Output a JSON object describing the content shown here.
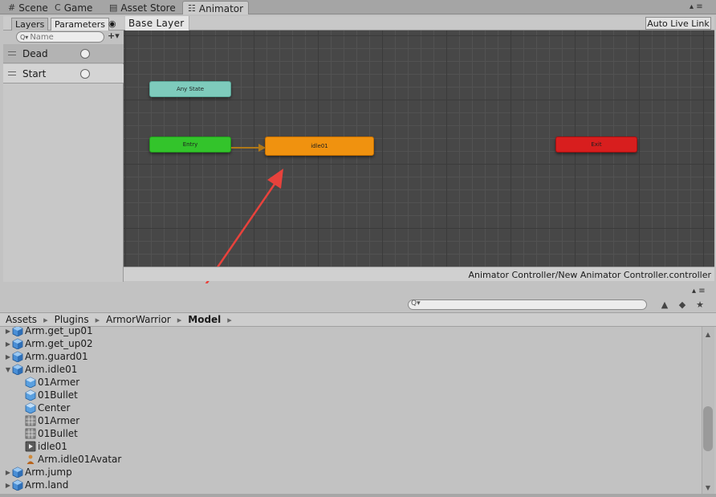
{
  "top_tabs": [
    {
      "label": "Scene",
      "icon": "scene-icon",
      "glyph": "#"
    },
    {
      "label": "Game",
      "icon": "game-icon",
      "glyph": "C"
    },
    {
      "label": "Asset Store",
      "icon": "asset-store-icon",
      "glyph": "▤"
    },
    {
      "label": "Animator",
      "icon": "animator-icon",
      "glyph": "☷",
      "active": true
    }
  ],
  "animator": {
    "sub_tabs": [
      "Layers",
      "Parameters"
    ],
    "active_sub_tab": "Parameters",
    "eye_glyph": "◉",
    "search_placeholder": "Name",
    "search_glyph": "Q▾",
    "add_glyph": "+▾",
    "parameters": [
      {
        "name": "Dead"
      },
      {
        "name": "Start"
      }
    ],
    "layer_breadcrumb": "Base Layer",
    "auto_live_link": "Auto Live Link",
    "states": {
      "any_state": "Any State",
      "entry": "Entry",
      "idle": "idle01",
      "exit": "Exit"
    },
    "controller_path": "Animator Controller/New Animator Controller.controller",
    "colors": {
      "any_state": "#7ecbbc",
      "entry": "#33c42b",
      "idle": "#f0920f",
      "exit": "#d81e1e",
      "graph_bg": "#474747",
      "annotation": "#e8423c"
    }
  },
  "project": {
    "window_controls": "▴ ≡",
    "search_value": "",
    "toolbar_icons": [
      "filter-icon",
      "label-icon",
      "favorite-icon"
    ],
    "toolbar_glyphs": [
      "▲",
      "◆",
      "★"
    ],
    "breadcrumbs": [
      "Assets",
      "Plugins",
      "ArmorWarrior",
      "Model"
    ],
    "crumb_sep": "▸",
    "scroll_glyphs": [
      "▲",
      "▼"
    ],
    "tree": [
      {
        "label": "Arm.get_up01",
        "level": 0,
        "arrow": "▶",
        "icon": "model-icon"
      },
      {
        "label": "Arm.get_up02",
        "level": 0,
        "arrow": "▶",
        "icon": "model-icon"
      },
      {
        "label": "Arm.guard01",
        "level": 0,
        "arrow": "▶",
        "icon": "model-icon"
      },
      {
        "label": "Arm.idle01",
        "level": 0,
        "arrow": "▼",
        "icon": "model-icon"
      },
      {
        "label": "01Armer",
        "level": 1,
        "arrow": "",
        "icon": "mesh-object-icon"
      },
      {
        "label": "01Bullet",
        "level": 1,
        "arrow": "",
        "icon": "mesh-object-icon"
      },
      {
        "label": "Center",
        "level": 1,
        "arrow": "",
        "icon": "mesh-object-icon"
      },
      {
        "label": "01Armer",
        "level": 1,
        "arrow": "",
        "icon": "mesh-grid-icon"
      },
      {
        "label": "01Bullet",
        "level": 1,
        "arrow": "",
        "icon": "mesh-grid-icon"
      },
      {
        "label": "idle01",
        "level": 1,
        "arrow": "",
        "icon": "animation-clip-icon"
      },
      {
        "label": "Arm.idle01Avatar",
        "level": 1,
        "arrow": "",
        "icon": "avatar-icon"
      },
      {
        "label": "Arm.jump",
        "level": 0,
        "arrow": "▶",
        "icon": "model-icon"
      },
      {
        "label": "Arm.land",
        "level": 0,
        "arrow": "▶",
        "icon": "model-icon"
      }
    ]
  }
}
